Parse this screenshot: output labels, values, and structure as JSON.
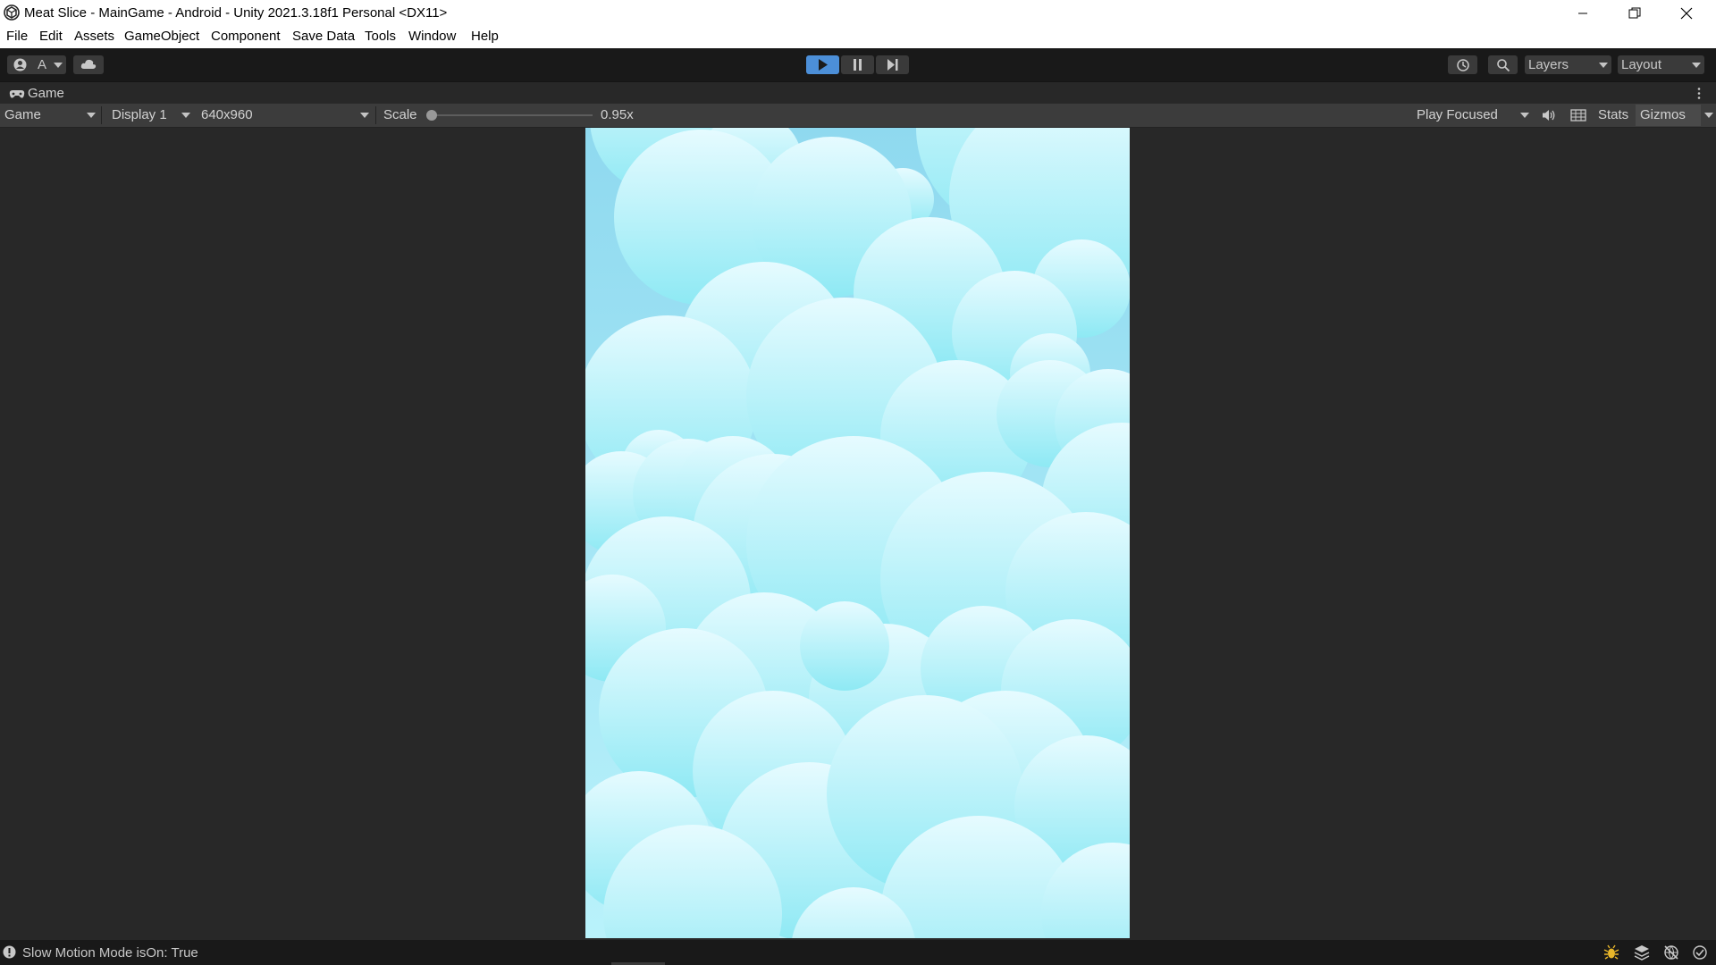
{
  "window": {
    "title": "Meat Slice - MainGame - Android - Unity 2021.3.18f1 Personal <DX11>",
    "icon": "unity-logo-icon",
    "controls": [
      "minimize-icon",
      "restore-icon",
      "close-icon"
    ]
  },
  "menu": {
    "items": [
      "File",
      "Edit",
      "Assets",
      "GameObject",
      "Component",
      "Save Data",
      "Tools",
      "Window",
      "Help"
    ]
  },
  "toolbar": {
    "account_label": "A",
    "account_icon": "account-icon",
    "cloud_icon": "cloud-icon",
    "play_icon": "play-icon",
    "play_active": true,
    "pause_icon": "pause-icon",
    "step_icon": "step-icon",
    "history_icon": "history-icon",
    "search_icon": "search-icon",
    "layers_label": "Layers",
    "layout_label": "Layout",
    "accent_color": "#4c8fd8"
  },
  "panel": {
    "tab_label": "Game",
    "tab_icon": "gamepad-icon",
    "menu_icon": "kebab-menu-icon"
  },
  "gamebar": {
    "view_select": "Game",
    "display_select": "Display 1",
    "resolution_select": "640x960",
    "scale_label": "Scale",
    "scale_value": "0.95x",
    "scale_fraction": 0.0,
    "play_mode_select": "Play Focused",
    "audio_icon": "speaker-icon",
    "grid_icon": "grid-icon",
    "stats_label": "Stats",
    "gizmos_label": "Gizmos"
  },
  "game_view": {
    "background_top": "#8fd9ef",
    "cloud_top_color": "#e6fbff",
    "cloud_bottom_color": "#8ee9f4"
  },
  "status": {
    "info_icon": "info-icon",
    "message": "Slow Motion Mode isOn: True",
    "right_icons": [
      "debug-bug-icon",
      "layers-stack-icon",
      "network-off-icon",
      "check-circle-icon"
    ]
  }
}
